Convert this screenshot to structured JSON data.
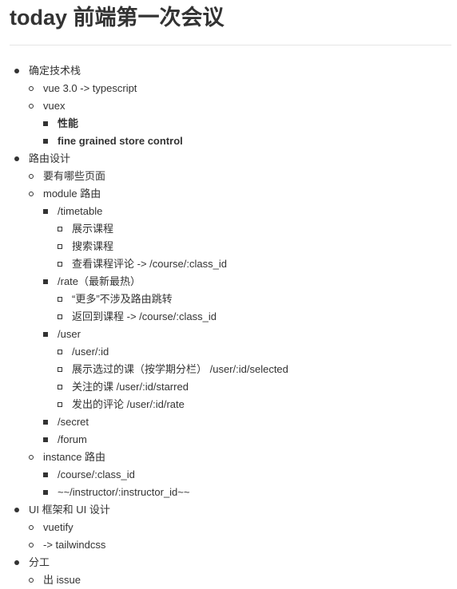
{
  "doc": {
    "title": "today 前端第一次会议"
  },
  "items": [
    {
      "text": "确定技术栈",
      "level": 1
    },
    {
      "text": "vue 3.0 -> typescript",
      "level": 2
    },
    {
      "text": "vuex",
      "level": 2
    },
    {
      "text": "性能",
      "level": 3,
      "bold": true
    },
    {
      "text": "fine grained store control",
      "level": 3,
      "bold": true
    },
    {
      "text": "路由设计",
      "level": 1
    },
    {
      "text": "要有哪些页面",
      "level": 2
    },
    {
      "text": "module 路由",
      "level": 2
    },
    {
      "text": "/timetable",
      "level": 3
    },
    {
      "text": "展示课程",
      "level": 4
    },
    {
      "text": "搜索课程",
      "level": 4
    },
    {
      "text": "查看课程评论 -> /course/:class_id",
      "level": 4
    },
    {
      "text": "/rate（最新最热）",
      "level": 3
    },
    {
      "text": "“更多”不涉及路由跳转",
      "level": 4
    },
    {
      "text": "返回到课程 -> /course/:class_id",
      "level": 4
    },
    {
      "text": "/user",
      "level": 3
    },
    {
      "text": "/user/:id",
      "level": 4
    },
    {
      "text": "展示选过的课（按学期分栏） /user/:id/selected",
      "level": 4
    },
    {
      "text": "关注的课 /user/:id/starred",
      "level": 4
    },
    {
      "text": "发出的评论 /user/:id/rate",
      "level": 4
    },
    {
      "text": "/secret",
      "level": 3
    },
    {
      "text": "/forum",
      "level": 3
    },
    {
      "text": "instance 路由",
      "level": 2
    },
    {
      "text": "/course/:class_id",
      "level": 3
    },
    {
      "text": "~~/instructor/:instructor_id~~",
      "level": 3
    },
    {
      "text": "UI 框架和 UI 设计",
      "level": 1
    },
    {
      "text": "vuetify",
      "level": 2
    },
    {
      "text": "-> tailwindcss",
      "level": 2
    },
    {
      "text": "分工",
      "level": 1
    },
    {
      "text": "出 issue",
      "level": 2
    }
  ]
}
